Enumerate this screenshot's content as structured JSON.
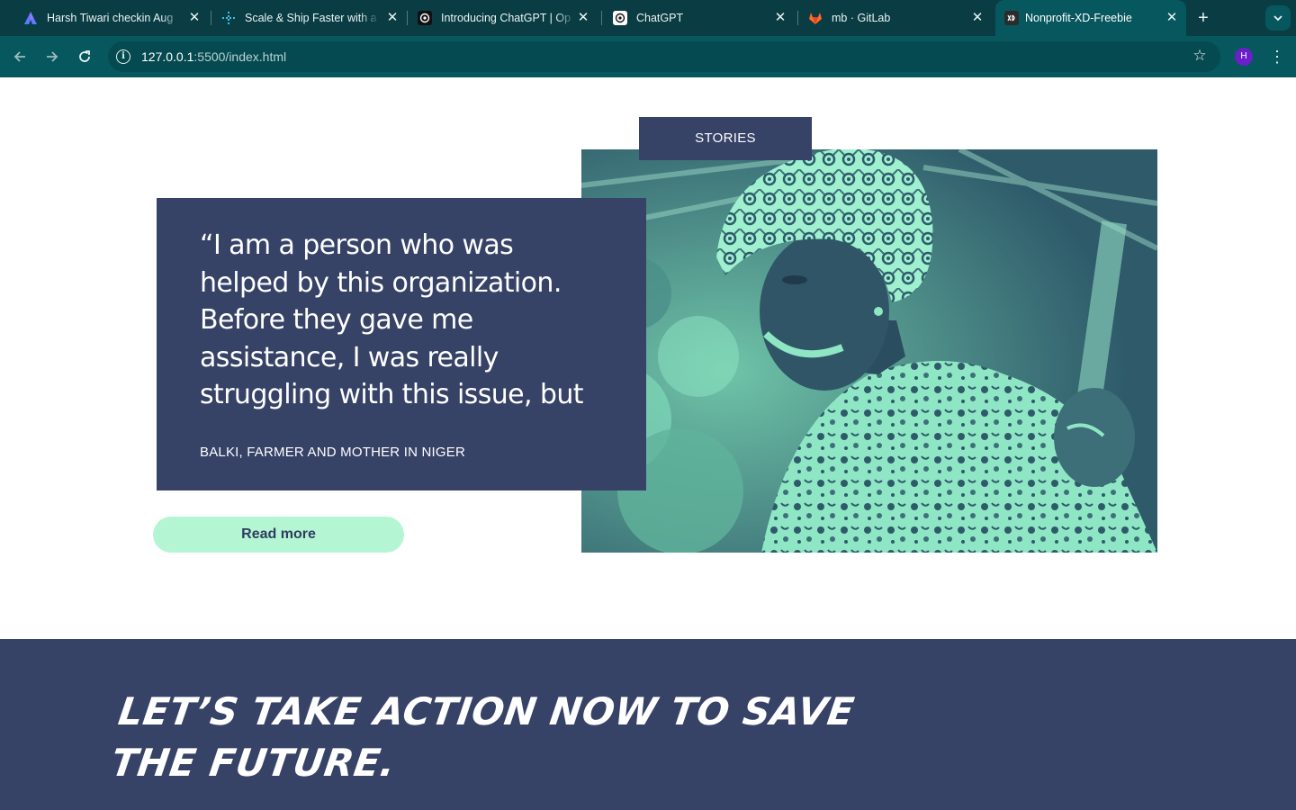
{
  "browser": {
    "tabs": [
      {
        "title": "Harsh Tiwari checkin Aug",
        "icon": "arrow-logo-icon",
        "active": false
      },
      {
        "title": "Scale & Ship Faster with a",
        "icon": "sparkle-logo-icon",
        "active": false
      },
      {
        "title": "Introducing ChatGPT | Op",
        "icon": "openai-logo-icon",
        "active": false
      },
      {
        "title": "ChatGPT",
        "icon": "openai-logo-icon",
        "active": false
      },
      {
        "title": "mb · GitLab",
        "icon": "gitlab-logo-icon",
        "active": false
      },
      {
        "title": "Nonprofit-XD-Freebie",
        "icon": "xd-logo-icon",
        "active": true
      }
    ],
    "close_glyph": "✕",
    "new_tab_glyph": "+",
    "url_host": "127.0.0.1",
    "url_rest": ":5500/index.html",
    "profile_initial": "H",
    "colors": {
      "tabstrip": "#0a3c43",
      "toolbar": "#07575e",
      "avatar": "#6a1fc9"
    }
  },
  "page": {
    "stories_label": "STORIES",
    "quote": "“I am a person who was helped by this organization. Before they gave me assistance, I was really struggling with this issue, but",
    "author": "BALKI, FARMER AND MOTHER IN NIGER",
    "read_more": "Read more",
    "cta_heading": "LET’S TAKE ACTION NOW TO SAVE THE FUTURE.",
    "colors": {
      "navy": "#364266",
      "mint": "#b4f6d3",
      "photo_dark": "#2e5a6a",
      "photo_light": "#8fe6c4"
    }
  }
}
